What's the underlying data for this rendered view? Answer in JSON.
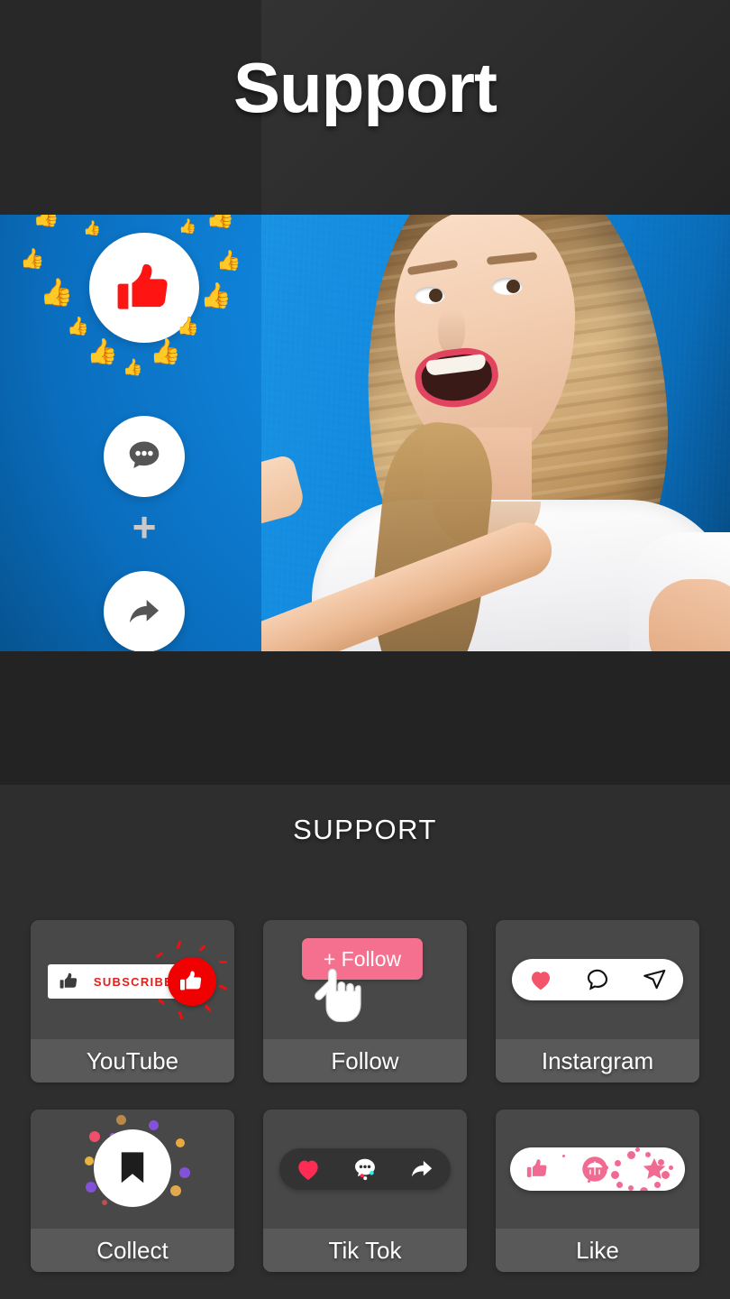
{
  "header": {
    "title": "Support"
  },
  "hero": {
    "icons": [
      {
        "name": "thumbs-up-icon",
        "color": "#ff1414",
        "circle": "#ffffff"
      },
      {
        "name": "comment-dots-icon",
        "color": "#555555",
        "circle": "#ffffff"
      },
      {
        "name": "plus-icon",
        "color": "#c9c9c9"
      },
      {
        "name": "share-arrow-icon",
        "color": "#555555",
        "circle": "#ffffff"
      }
    ],
    "background_color": "#0f82d8",
    "particle_color": "#ff1414"
  },
  "panel": {
    "title": "SUPPORT",
    "cards": [
      {
        "id": "youtube",
        "label": "YouTube",
        "art": "subscribe-button",
        "subscribe_text": "SUBSCRIBE",
        "accent": "#e0201b"
      },
      {
        "id": "follow",
        "label": "Follow",
        "art": "follow-button",
        "button_text": "+ Follow",
        "accent": "#f4708e"
      },
      {
        "id": "instargram",
        "label": "Instargram",
        "art": "instagram-action-bar",
        "accent": "#ed4956"
      },
      {
        "id": "collect",
        "label": "Collect",
        "art": "bookmark-burst",
        "accent": "#ffffff"
      },
      {
        "id": "tiktok",
        "label": "Tik Tok",
        "art": "tiktok-action-bar",
        "accent": "#fe2c55"
      },
      {
        "id": "like",
        "label": "Like",
        "art": "like-star-bar",
        "accent": "#f06b92"
      }
    ]
  },
  "colors": {
    "app_background": "#262626",
    "panel_background": "#2e2e2e",
    "card_background": "#484848",
    "card_label_background": "#595959",
    "text_primary": "#ffffff"
  }
}
